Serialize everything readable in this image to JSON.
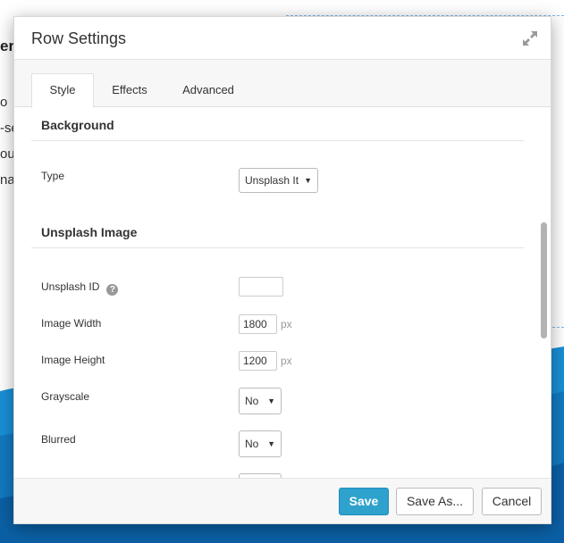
{
  "background_page": {
    "heading_fragment": "er",
    "text_fragments": [
      "o",
      "-se",
      "ou",
      "nag"
    ]
  },
  "colors": {
    "primary_button": "#2ea2cc",
    "background_wave": "#1a8fd6"
  },
  "modal": {
    "title": "Row Settings",
    "expand_icon": "expand-arrows-icon",
    "tabs": [
      {
        "label": "Style",
        "active": true
      },
      {
        "label": "Effects",
        "active": false
      },
      {
        "label": "Advanced",
        "active": false
      }
    ],
    "sections": {
      "background": {
        "title": "Background",
        "type_label": "Type",
        "type_value": "Unsplash It"
      },
      "unsplash": {
        "title": "Unsplash Image",
        "id_label": "Unsplash ID",
        "id_value": "",
        "width_label": "Image Width",
        "width_value": "1800",
        "height_label": "Image Height",
        "height_value": "1200",
        "unit": "px",
        "grayscale_label": "Grayscale",
        "grayscale_value": "No",
        "blurred_label": "Blurred",
        "blurred_value": "No"
      }
    },
    "footer": {
      "save": "Save",
      "save_as": "Save As...",
      "cancel": "Cancel"
    }
  }
}
